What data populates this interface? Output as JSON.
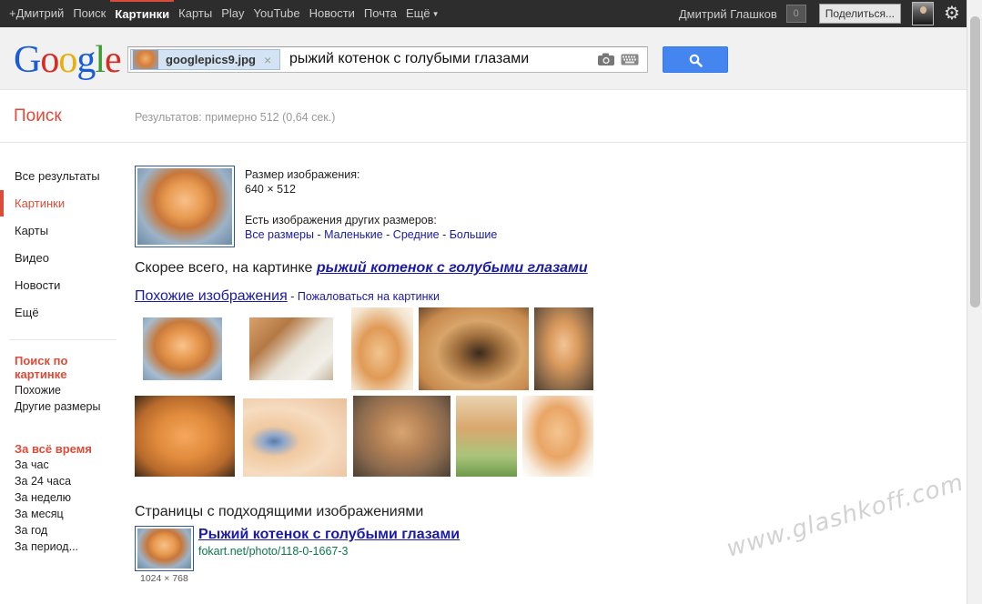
{
  "topbar": {
    "nav": [
      {
        "label": "+Дмитрий"
      },
      {
        "label": "Поиск"
      },
      {
        "label": "Картинки",
        "active": true
      },
      {
        "label": "Карты"
      },
      {
        "label": "Play"
      },
      {
        "label": "YouTube"
      },
      {
        "label": "Новости"
      },
      {
        "label": "Почта"
      },
      {
        "label": "Ещё"
      }
    ],
    "username": "Дмитрий Глашков",
    "notifications": "0",
    "share_label": "Поделиться..."
  },
  "search": {
    "logo": [
      "G",
      "o",
      "o",
      "g",
      "l",
      "e"
    ],
    "chip_filename": "googlepics9.jpg",
    "chip_close": "×",
    "query": "рыжий котенок с голубыми глазами"
  },
  "results_header": {
    "title": "Поиск",
    "stats": "Результатов: примерно 512 (0,64 сек.)"
  },
  "sidebar": {
    "items": [
      "Все результаты",
      "Картинки",
      "Карты",
      "Видео",
      "Новости",
      "Ещё"
    ],
    "selected": "Картинки",
    "image_search_heading": "Поиск по картинке",
    "image_search_items": [
      "Похожие",
      "Другие размеры"
    ],
    "time_heading": "За всё время",
    "time_items": [
      "За час",
      "За 24 часа",
      "За неделю",
      "За месяц",
      "За год",
      "За период..."
    ]
  },
  "query_image": {
    "size_label": "Размер изображения:",
    "size_value": "640 × 512",
    "other_sizes_label": "Есть изображения других размеров:",
    "size_links": [
      "Все размеры",
      "Маленькие",
      "Средние",
      "Большие"
    ],
    "size_sep": " - "
  },
  "best_guess": {
    "prefix": "Скорее всего, на картинке ",
    "link": "рыжий котенок с голубыми глазами"
  },
  "similar": {
    "link": "Похожие изображения",
    "sep": " - ",
    "report": "Пожаловаться на картинки"
  },
  "pages": {
    "title": "Страницы с подходящими изображениями",
    "results": [
      {
        "title": "Рыжий котенок с голубыми глазами",
        "url": "fokart.net/photo/118-0-1667-3",
        "dims": "1024 × 768"
      }
    ]
  },
  "watermark": "www.glashkoff.com",
  "colors": {
    "accent_red": "#dd4b39",
    "link_blue": "#1a1aa6",
    "url_green": "#0e774a",
    "search_button": "#4585ef",
    "topbar": "#2d2d2d"
  }
}
